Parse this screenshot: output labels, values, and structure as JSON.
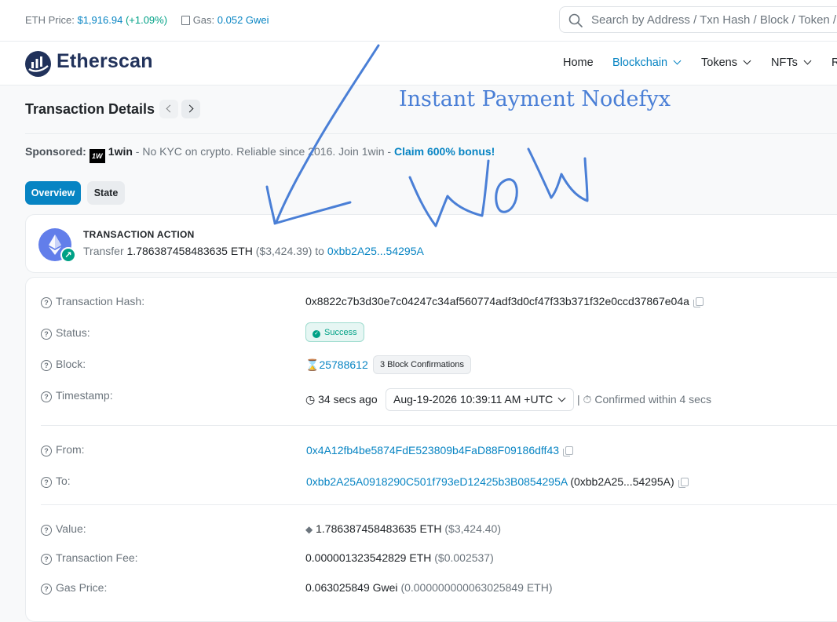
{
  "topbar": {
    "eth_price_label": "ETH Price:",
    "eth_price": "$1,916.94",
    "eth_change": "(+1.09%)",
    "gas_label": "Gas:",
    "gas_value": "0.052 Gwei",
    "search_placeholder": "Search by Address / Txn Hash / Block / Token / Domain Name"
  },
  "nav": {
    "logo": "Etherscan",
    "items": [
      {
        "label": "Home"
      },
      {
        "label": "Blockchain"
      },
      {
        "label": "Tokens"
      },
      {
        "label": "NFTs"
      },
      {
        "label": "R"
      }
    ]
  },
  "page": {
    "title": "Transaction Details",
    "sponsored_label": "Sponsored:",
    "sponsor_logo": "1W",
    "sponsor_name": "1win",
    "sponsor_text": " - No KYC on crypto. Reliable since 2016. Join 1win - ",
    "sponsor_cta": "Claim 600% bonus!",
    "tabs": [
      {
        "label": "Overview"
      },
      {
        "label": "State"
      }
    ]
  },
  "action": {
    "label": "TRANSACTION ACTION",
    "prefix": "Transfer",
    "amount": "1.786387458483635 ETH",
    "usd": "($3,424.39)",
    "to_word": "to",
    "to_address": "0xbb2A25...54295A"
  },
  "details": {
    "tx_hash_label": "Transaction Hash:",
    "tx_hash": "0x8822c7b3d30e7c04247c34af560774adf3d0cf47f33b371f32e0ccd37867e04a",
    "status_label": "Status:",
    "status": "Success",
    "block_label": "Block:",
    "block": "25788612",
    "block_confirmations": "3 Block Confirmations",
    "timestamp_label": "Timestamp:",
    "timestamp_age": "34 secs ago",
    "timestamp_value": "Aug-19-2026 10:39:11 AM +UTC",
    "confirmed_within": "Confirmed within 4 secs",
    "from_label": "From:",
    "from": "0x4A12fb4be5874FdE523809b4FaD88F09186dff43",
    "to_label": "To:",
    "to": "0xbb2A25A0918290C501f793eD12425b3B0854295A",
    "to_short": "(0xbb2A25...54295A)",
    "value_label": "Value:",
    "value": "1.786387458483635 ETH",
    "value_usd": "($3,424.40)",
    "fee_label": "Transaction Fee:",
    "fee": "0.000001323542829 ETH",
    "fee_usd": "($0.002537)",
    "gas_price_label": "Gas Price:",
    "gas_price": "0.063025849 Gwei",
    "gas_price_eth": "(0.000000000063025849 ETH)"
  },
  "annotations": {
    "title": "Instant Payment Nodefyx",
    "handwriting": "WoW",
    "color": "#4a7fd6"
  },
  "colors": {
    "link": "#0784c3",
    "success": "#00a186",
    "eth": "#627eea"
  }
}
